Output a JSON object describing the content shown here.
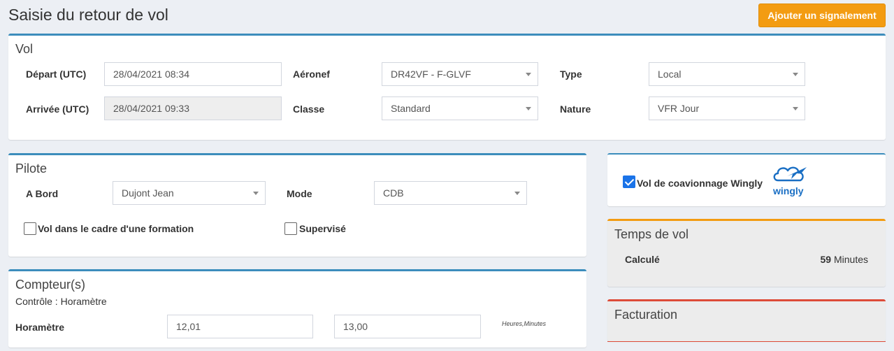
{
  "page": {
    "title": "Saisie du retour de vol"
  },
  "toolbar": {
    "report_label": "Ajouter un signalement"
  },
  "vol": {
    "title": "Vol",
    "depart": {
      "label": "Départ (UTC)",
      "value": "28/04/2021 08:34"
    },
    "arrivee": {
      "label": "Arrivée (UTC)",
      "value": "28/04/2021 09:33"
    },
    "aeronef": {
      "label": "Aéronef",
      "value": "DR42VF - F-GLVF"
    },
    "classe": {
      "label": "Classe",
      "value": "Standard"
    },
    "type": {
      "label": "Type",
      "value": "Local"
    },
    "nature": {
      "label": "Nature",
      "value": "VFR Jour"
    }
  },
  "pilote": {
    "title": "Pilote",
    "abord": {
      "label": "A Bord",
      "value": "Dujont Jean"
    },
    "mode": {
      "label": "Mode",
      "value": "CDB"
    },
    "formation": {
      "label": "Vol dans le cadre d'une formation",
      "checked": false
    },
    "supervise": {
      "label": "Supervisé",
      "checked": false
    }
  },
  "compteurs": {
    "title": "Compteur(s)",
    "controle": "Contrôle : Horamètre",
    "horametre": {
      "label": "Horamètre",
      "start": "12,01",
      "end": "13,00",
      "unit": "Heures,Minutes"
    }
  },
  "wingly": {
    "label": "Vol de coavionnage Wingly",
    "checked": true,
    "logo_text": "wingly"
  },
  "temps": {
    "title": "Temps de vol",
    "calcule_label": "Calculé",
    "value": "59",
    "unit": "Minutes"
  },
  "facturation": {
    "title": "Facturation"
  },
  "colors": {
    "accent": "#3c8dbc",
    "warning": "#f39c12",
    "danger": "#dd4b39",
    "wingly": "#1a6fc4"
  }
}
